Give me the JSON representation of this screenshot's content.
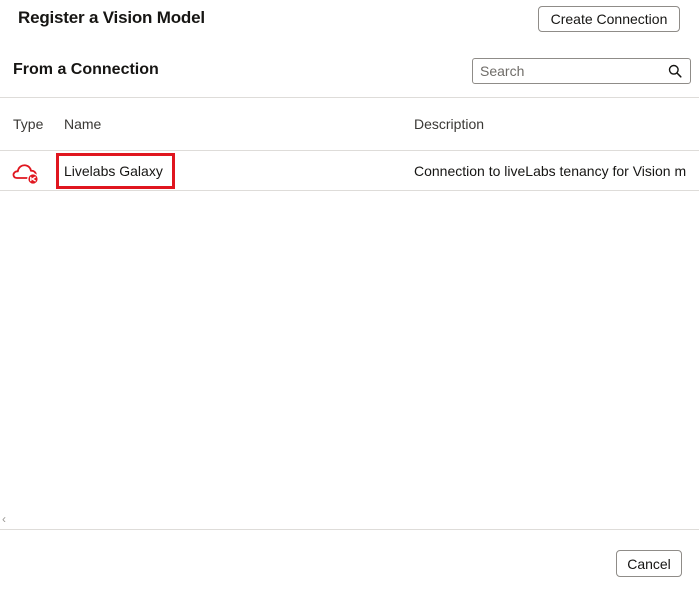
{
  "dialog": {
    "title": "Register a Vision Model",
    "create_button_label": "Create Connection",
    "cancel_button_label": "Cancel"
  },
  "section": {
    "title": "From a Connection"
  },
  "search": {
    "placeholder": "Search",
    "value": "",
    "icon": "search-icon"
  },
  "table": {
    "columns": [
      "Type",
      "Name",
      "Description"
    ],
    "rows": [
      {
        "type_icon": "cloud-connection-icon",
        "name": "Livelabs Galaxy",
        "description": "Connection to liveLabs tenancy for Vision m"
      }
    ]
  },
  "colors": {
    "accent_red": "#e0161f",
    "border": "#8f8c88",
    "divider": "#dedcd9"
  }
}
